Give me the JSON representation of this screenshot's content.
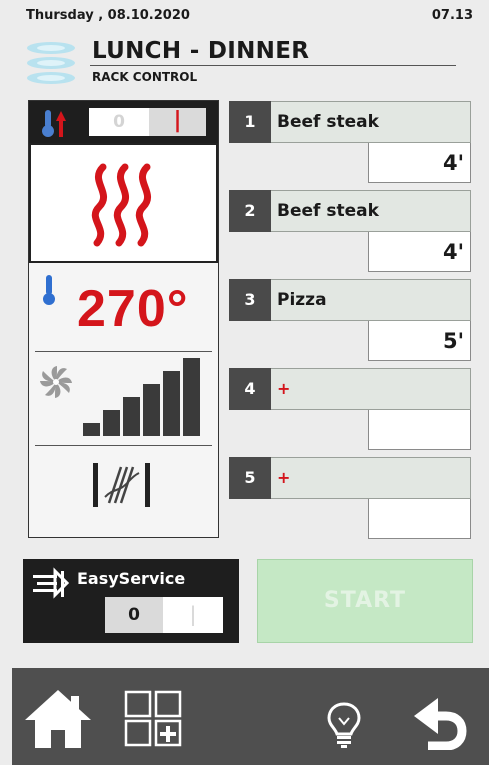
{
  "status": {
    "date": "Thursday , 08.10.2020",
    "time": "07.13"
  },
  "header": {
    "title": "LUNCH - DINNER",
    "subtitle": "RACK CONTROL",
    "icon": "stacked-plates-icon"
  },
  "mode": {
    "off_label": "0",
    "on_label": "|",
    "selected": "on",
    "icon": "thermometer-up-icon"
  },
  "heat": {
    "icon": "heat-waves-icon"
  },
  "temperature": {
    "value": "270°",
    "icon": "thermometer-icon"
  },
  "fan": {
    "icon": "fan-icon",
    "level": 6,
    "max_level": 6
  },
  "steam": {
    "icon": "steam-valve-icon"
  },
  "racks": [
    {
      "number": "1",
      "name": "Beef steak",
      "time": "4'"
    },
    {
      "number": "2",
      "name": "Beef steak",
      "time": "4'"
    },
    {
      "number": "3",
      "name": "Pizza",
      "time": "5'"
    },
    {
      "number": "4",
      "name": "+",
      "time": ""
    },
    {
      "number": "5",
      "name": "+",
      "time": ""
    }
  ],
  "easy_service": {
    "label": "EasyService",
    "off_label": "0",
    "on_label": "|",
    "selected": "off",
    "icon": "easy-service-icon"
  },
  "start": {
    "label": "START",
    "enabled": false
  },
  "nav": {
    "home": "home-icon",
    "programs": "programs-grid-icon",
    "light": "light-bulb-icon",
    "back": "back-arrow-icon"
  },
  "colors": {
    "accent_red": "#d4151b",
    "dark": "#1e1e1e",
    "start_disabled": "#c5e8c5",
    "bottom_bar": "#4f4f4f"
  }
}
